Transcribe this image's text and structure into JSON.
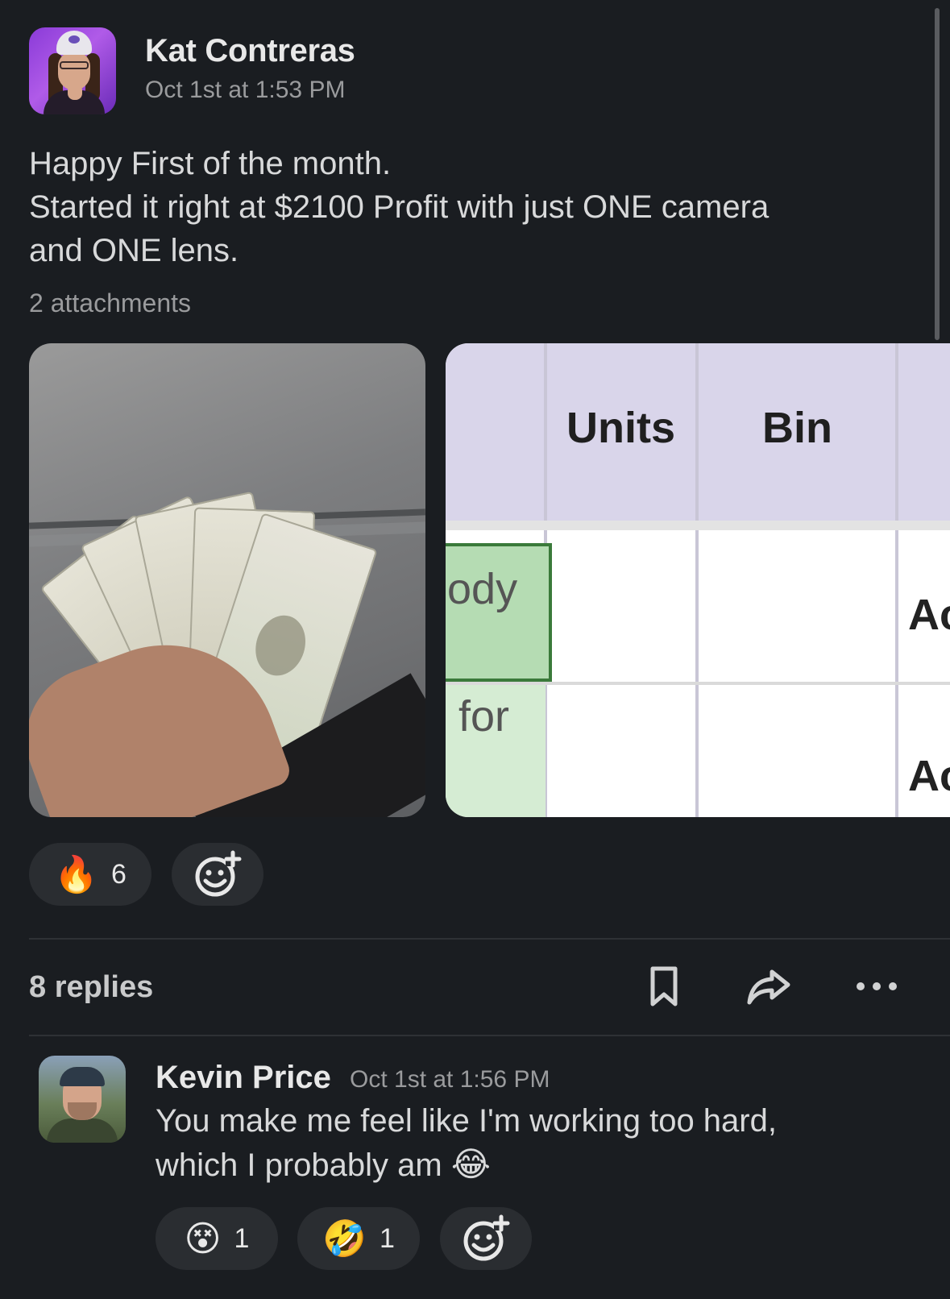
{
  "message": {
    "author": "Kat Contreras",
    "timestamp": "Oct 1st at 1:53 PM",
    "lines": [
      "Happy First of the month.",
      "Started it right at $2100 Profit with just ONE camera",
      "and ONE lens."
    ],
    "attachments_label": "2 attachments",
    "spreadsheet": {
      "headers": [
        "Units",
        "Bin"
      ],
      "cells": [
        "ody",
        "for",
        "Ac",
        "Ac"
      ]
    },
    "reactions": [
      {
        "emoji": "🔥",
        "name": "fire",
        "count": "6"
      }
    ]
  },
  "thread": {
    "replies_label": "8 replies"
  },
  "reply": {
    "author": "Kevin Price",
    "timestamp": "Oct 1st at 1:56 PM",
    "lines": [
      "You make me feel like I'm working too hard,",
      "which I probably am"
    ],
    "inline_emoji": "😂",
    "reactions": [
      {
        "emoji": "😵",
        "name": "dizzy-face",
        "count": "1"
      },
      {
        "emoji": "🤣",
        "name": "rolling-on-floor-laughing",
        "count": "1"
      }
    ]
  },
  "icons": {
    "add_reaction": "add-reaction-icon",
    "save": "bookmark-icon",
    "share": "share-icon",
    "more": "more-horizontal-icon"
  }
}
